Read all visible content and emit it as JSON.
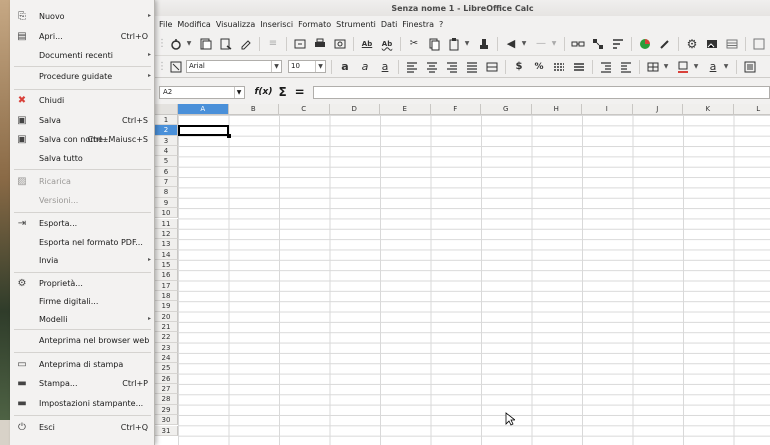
{
  "window_title": "Senza nome 1 - LibreOffice Calc",
  "menubar": [
    "File",
    "Modifica",
    "Visualizza",
    "Inserisci",
    "Formato",
    "Strumenti",
    "Dati",
    "Finestra",
    "?"
  ],
  "toolbar": {
    "font_name": "Arial",
    "font_size": "10",
    "bold": "a",
    "italic": "a",
    "underline": "a",
    "currency": "$",
    "percent": "%",
    "spell_label": "Ab"
  },
  "formula_bar": {
    "name_box": "A2",
    "fx": "f(x)",
    "sigma": "Σ",
    "equals": "="
  },
  "columns": [
    "A",
    "B",
    "C",
    "D",
    "E",
    "F",
    "G",
    "H",
    "I",
    "J",
    "K",
    "L"
  ],
  "rows": [
    "1",
    "2",
    "3",
    "4",
    "5",
    "6",
    "7",
    "8",
    "9",
    "10",
    "11",
    "12",
    "13",
    "14",
    "15",
    "16",
    "17",
    "18",
    "19",
    "20",
    "21",
    "22",
    "23",
    "24",
    "25",
    "26",
    "27",
    "28",
    "29",
    "30",
    "31"
  ],
  "selected": {
    "column": "A",
    "row": "2"
  },
  "file_menu": {
    "items": [
      {
        "label": "Nuovo",
        "shortcut": "",
        "submenu": true,
        "icon": "new-document-icon",
        "disabled": false
      },
      {
        "label": "Apri...",
        "shortcut": "Ctrl+O",
        "submenu": false,
        "icon": "open-folder-icon",
        "disabled": false
      },
      {
        "label": "Documenti recenti",
        "shortcut": "",
        "submenu": true,
        "icon": "",
        "disabled": false
      },
      {
        "label": "Procedure guidate",
        "shortcut": "",
        "submenu": true,
        "icon": "",
        "disabled": false
      },
      {
        "label": "Chiudi",
        "shortcut": "",
        "submenu": false,
        "icon": "close-document-icon",
        "disabled": false
      },
      {
        "label": "Salva",
        "shortcut": "Ctrl+S",
        "submenu": false,
        "icon": "save-icon",
        "disabled": false
      },
      {
        "label": "Salva con nome...",
        "shortcut": "Ctrl+Maiusc+S",
        "submenu": false,
        "icon": "save-as-icon",
        "disabled": false
      },
      {
        "label": "Salva tutto",
        "shortcut": "",
        "submenu": false,
        "icon": "",
        "disabled": false
      },
      {
        "label": "Ricarica",
        "shortcut": "",
        "submenu": false,
        "icon": "reload-icon",
        "disabled": true
      },
      {
        "label": "Versioni...",
        "shortcut": "",
        "submenu": false,
        "icon": "",
        "disabled": true
      },
      {
        "label": "Esporta...",
        "shortcut": "",
        "submenu": false,
        "icon": "export-icon",
        "disabled": false
      },
      {
        "label": "Esporta nel formato PDF...",
        "shortcut": "",
        "submenu": false,
        "icon": "",
        "disabled": false
      },
      {
        "label": "Invia",
        "shortcut": "",
        "submenu": true,
        "icon": "",
        "disabled": false
      },
      {
        "label": "Proprietà...",
        "shortcut": "",
        "submenu": false,
        "icon": "properties-gear-icon",
        "disabled": false
      },
      {
        "label": "Firme digitali...",
        "shortcut": "",
        "submenu": false,
        "icon": "",
        "disabled": false
      },
      {
        "label": "Modelli",
        "shortcut": "",
        "submenu": true,
        "icon": "",
        "disabled": false
      },
      {
        "label": "Anteprima nel browser web",
        "shortcut": "",
        "submenu": false,
        "icon": "",
        "disabled": false
      },
      {
        "label": "Anteprima di stampa",
        "shortcut": "",
        "submenu": false,
        "icon": "print-preview-icon",
        "disabled": false
      },
      {
        "label": "Stampa...",
        "shortcut": "Ctrl+P",
        "submenu": false,
        "icon": "printer-icon",
        "disabled": false
      },
      {
        "label": "Impostazioni stampante...",
        "shortcut": "",
        "submenu": false,
        "icon": "printer-settings-icon",
        "disabled": false
      },
      {
        "label": "Esci",
        "shortcut": "Ctrl+Q",
        "submenu": false,
        "icon": "power-icon",
        "disabled": false
      }
    ]
  },
  "colors": {
    "selection": "#4a90d9",
    "close_red": "#d9413a"
  }
}
